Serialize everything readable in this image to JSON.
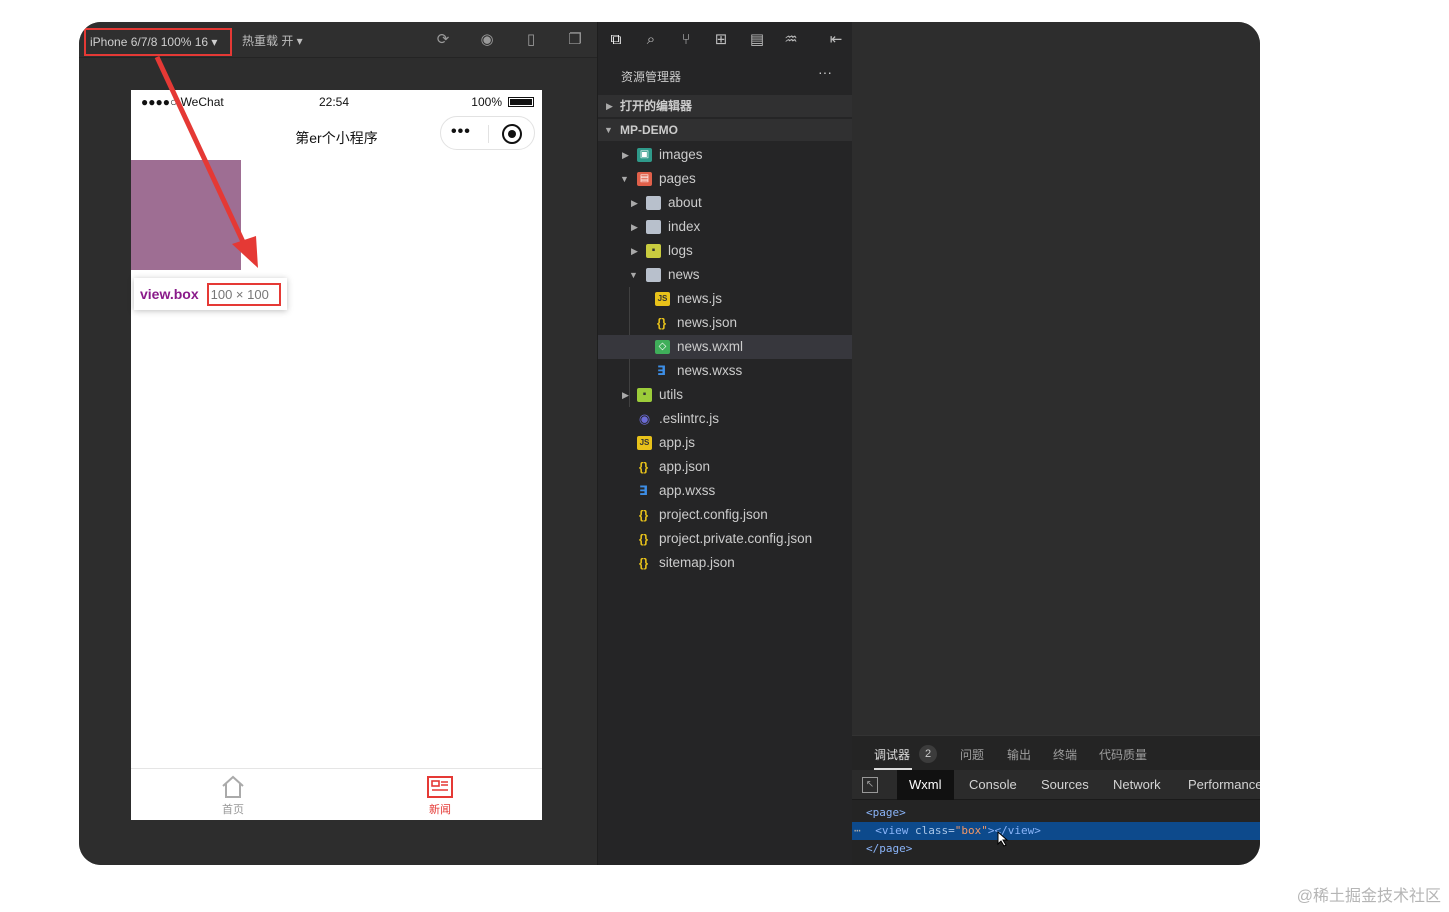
{
  "toolbar": {
    "device": "iPhone 6/7/8 100% 16 ▾",
    "hot_reload": "热重载 开 ▾"
  },
  "phone": {
    "status_left": "●●●●○ WeChat",
    "time": "22:54",
    "battery": "100%",
    "nav_title": "第er个小程序",
    "tooltip_name": "view.box",
    "tooltip_size": "100 × 100",
    "tabs": [
      {
        "label": "首页",
        "icon": "home-icon"
      },
      {
        "label": "新闻",
        "icon": "news-icon"
      }
    ],
    "colors": {
      "box": "#9e6e93",
      "tab_active": "#e53935"
    }
  },
  "explorer": {
    "title": "资源管理器",
    "more": "···",
    "open_editors": "打开的编辑器",
    "project": "MP-DEMO",
    "tree": [
      {
        "name": "images",
        "icon": "folder-images-icon"
      },
      {
        "name": "pages",
        "icon": "folder-pages-icon"
      },
      {
        "name": "about",
        "icon": "folder-icon"
      },
      {
        "name": "index",
        "icon": "folder-icon"
      },
      {
        "name": "logs",
        "icon": "folder-logs-icon"
      },
      {
        "name": "news",
        "icon": "folder-open-icon"
      },
      {
        "name": "news.js",
        "icon": "js-file-icon"
      },
      {
        "name": "news.json",
        "icon": "json-file-icon"
      },
      {
        "name": "news.wxml",
        "icon": "wxml-file-icon"
      },
      {
        "name": "news.wxss",
        "icon": "wxss-file-icon"
      },
      {
        "name": "utils",
        "icon": "folder-utils-icon"
      },
      {
        "name": ".eslintrc.js",
        "icon": "eslint-file-icon"
      },
      {
        "name": "app.js",
        "icon": "js-file-icon"
      },
      {
        "name": "app.json",
        "icon": "json-file-icon"
      },
      {
        "name": "app.wxss",
        "icon": "wxss-file-icon"
      },
      {
        "name": "project.config.json",
        "icon": "json-file-icon"
      },
      {
        "name": "project.private.config.json",
        "icon": "json-file-icon"
      },
      {
        "name": "sitemap.json",
        "icon": "json-file-icon"
      }
    ]
  },
  "devtools": {
    "tabs": [
      "调试器",
      "问题",
      "输出",
      "终端",
      "代码质量"
    ],
    "badge": "2",
    "panels": [
      "Wxml",
      "Console",
      "Sources",
      "Network",
      "Performance"
    ],
    "code": {
      "line1": "<page>",
      "line2_open": "<view ",
      "line2_attr": "class=",
      "line2_val": "\"box\"",
      "line2_close": "></view>",
      "line3": "</page>"
    }
  },
  "watermark": "@稀土掘金技术社区"
}
